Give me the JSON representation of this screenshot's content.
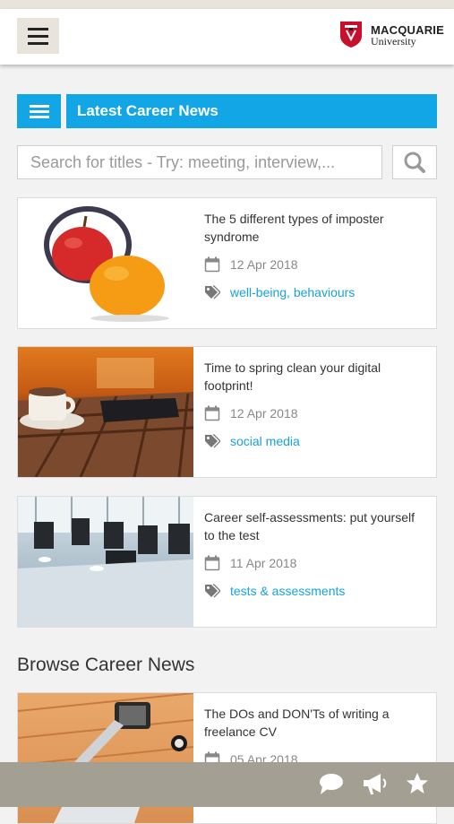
{
  "header": {
    "logo_name": "MACQUARIE",
    "logo_sub": "University"
  },
  "section": {
    "title": "Latest Career News"
  },
  "search": {
    "placeholder": "Search for titles - Try: meeting, interview,..."
  },
  "latest_news": [
    {
      "title": "The 5 different types of imposter syndrome",
      "date": "12 Apr 2018",
      "tags": "well-being, behaviours"
    },
    {
      "title": "Time to spring clean your digital footprint!",
      "date": "12 Apr 2018",
      "tags": "social media"
    },
    {
      "title": "Career self-assessments: put yourself to the test",
      "date": "11 Apr 2018",
      "tags": "tests & assessments"
    }
  ],
  "browse": {
    "heading": "Browse Career News",
    "items": [
      {
        "title": "The DOs and DON'Ts of writing a freelance CV",
        "date": "05 Apr 2018"
      }
    ]
  },
  "colors": {
    "accent": "#12a6e6",
    "bottom_bar": "#a39f93",
    "header_button": "#e8e4dc",
    "brand_red": "#c8102e"
  },
  "icons": {
    "menu": "hamburger-icon",
    "search": "search-icon",
    "date": "calendar-icon",
    "tags": "tag-icon",
    "bottom": [
      "chat-icon",
      "megaphone-icon",
      "star-icon"
    ]
  }
}
